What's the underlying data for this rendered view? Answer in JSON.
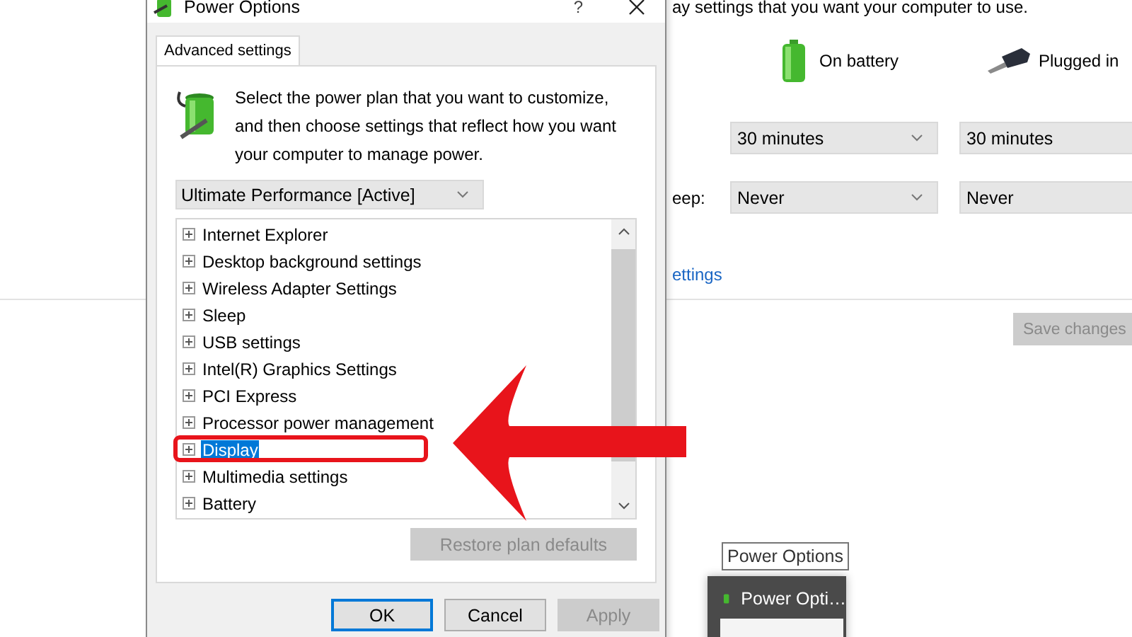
{
  "background_window": {
    "instruction": "ay settings that you want your computer to use.",
    "columns": [
      {
        "kind": "battery",
        "label": "On battery"
      },
      {
        "kind": "plug",
        "label": "Plugged in"
      }
    ],
    "rows": [
      {
        "values": [
          "30 minutes",
          "30 minutes"
        ]
      },
      {
        "label": "eep:",
        "values": [
          "Never",
          "Never"
        ]
      }
    ],
    "link": "ettings",
    "save_button": {
      "label": "Save changes",
      "disabled": true
    }
  },
  "dialog": {
    "title": "Power Options",
    "help": "?",
    "tabs": [
      {
        "label": "Advanced settings",
        "selected": true
      }
    ],
    "description": "Select the power plan that you want to customize, and then choose settings that reflect how you want your computer to manage power.",
    "plan": "Ultimate Performance [Active]",
    "settings": [
      {
        "label": "Internet Explorer",
        "expanded": false,
        "selected": false
      },
      {
        "label": "Desktop background settings",
        "expanded": false,
        "selected": false
      },
      {
        "label": "Wireless Adapter Settings",
        "expanded": false,
        "selected": false
      },
      {
        "label": "Sleep",
        "expanded": false,
        "selected": false
      },
      {
        "label": "USB settings",
        "expanded": false,
        "selected": false
      },
      {
        "label": "Intel(R) Graphics Settings",
        "expanded": false,
        "selected": false
      },
      {
        "label": "PCI Express",
        "expanded": false,
        "selected": false
      },
      {
        "label": "Processor power management",
        "expanded": false,
        "selected": false
      },
      {
        "label": "Display",
        "expanded": false,
        "selected": true
      },
      {
        "label": "Multimedia settings",
        "expanded": false,
        "selected": false
      },
      {
        "label": "Battery",
        "expanded": false,
        "selected": false
      }
    ],
    "restore_button": {
      "label": "Restore plan defaults",
      "disabled": true
    },
    "buttons": [
      {
        "label": "OK",
        "disabled": false,
        "default": true
      },
      {
        "label": "Cancel",
        "disabled": false,
        "default": false
      },
      {
        "label": "Apply",
        "disabled": true,
        "default": false
      }
    ]
  },
  "taskbar": {
    "tooltip": "Power Options",
    "thumbnail_title": "Power Opti…"
  }
}
